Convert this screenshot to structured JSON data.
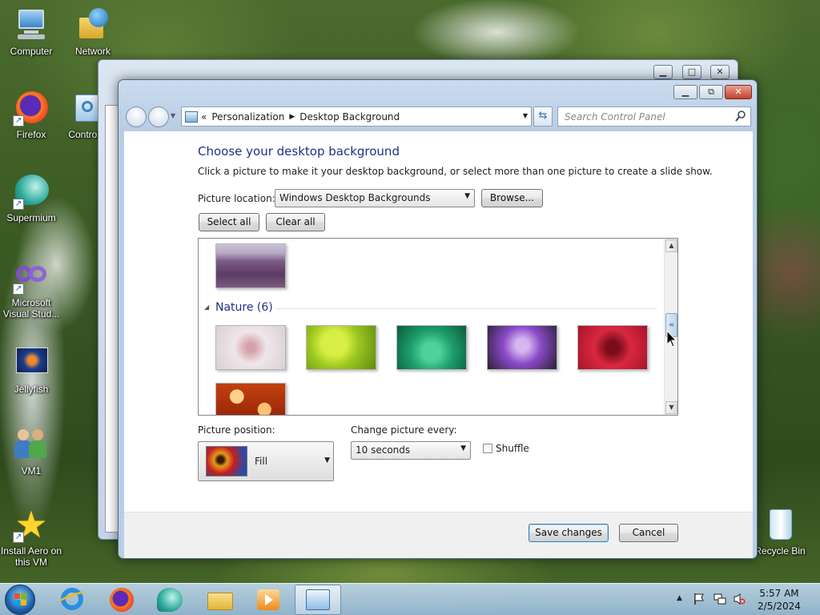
{
  "desktop": {
    "icons": [
      {
        "label": "Computer",
        "icon": "computer-icon"
      },
      {
        "label": "Network",
        "icon": "network-icon"
      },
      {
        "label": "Firefox",
        "icon": "firefox-icon"
      },
      {
        "label": "Control",
        "icon": "control-panel-icon"
      },
      {
        "label": "Supermium",
        "icon": "supermium-icon"
      },
      {
        "label": "Microsoft Visual Stud...",
        "icon": "visual-studio-icon"
      },
      {
        "label": "Jellyfish",
        "icon": "image-file-icon"
      },
      {
        "label": "VM1",
        "icon": "users-icon"
      },
      {
        "label": "Install Aero on this VM",
        "icon": "star-icon"
      },
      {
        "label": "Recycle Bin",
        "icon": "recycle-bin-icon"
      }
    ]
  },
  "window": {
    "breadcrumb": [
      "Personalization",
      "Desktop Background"
    ],
    "breadcrumb_prefix": "«",
    "search_placeholder": "Search Control Panel",
    "title": "Choose your desktop background",
    "subtitle": "Click a picture to make it your desktop background, or select more than one picture to create a slide show.",
    "picture_location_label": "Picture location:",
    "picture_location_value": "Windows Desktop Backgrounds",
    "browse_label": "Browse...",
    "select_all_label": "Select all",
    "clear_all_label": "Clear all",
    "group_name": "Nature (6)",
    "picture_position_label": "Picture position:",
    "picture_position_value": "Fill",
    "change_picture_label": "Change picture every:",
    "change_picture_value": "10 seconds",
    "shuffle_label": "Shuffle",
    "shuffle_checked": false,
    "save_label": "Save changes",
    "cancel_label": "Cancel"
  },
  "taskbar": {
    "apps": [
      "start-orb-icon",
      "internet-explorer-icon",
      "firefox-icon",
      "supermium-icon",
      "file-explorer-icon",
      "media-player-icon",
      "control-panel-icon"
    ],
    "time": "5:57 AM",
    "date": "2/5/2024"
  }
}
